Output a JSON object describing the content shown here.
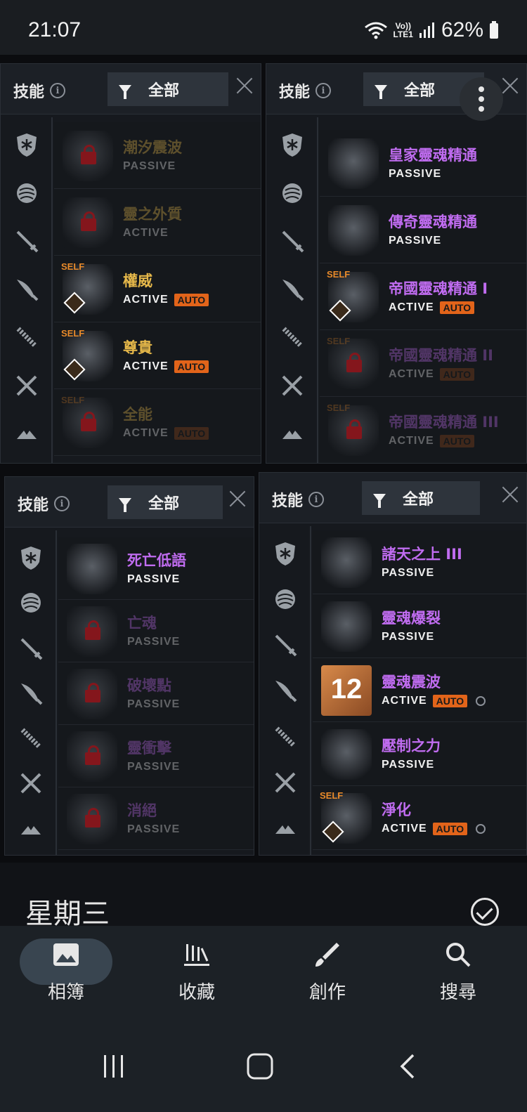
{
  "status_bar": {
    "time": "21:07",
    "network": "LTE1",
    "volte": "Vo))",
    "battery": "62%"
  },
  "panels": [
    {
      "title": "技能",
      "filter": "全部",
      "rows": [
        {
          "name": "潮汐震波",
          "type": "PASSIVE",
          "locked": true,
          "color": "gold"
        },
        {
          "name": "靈之外質",
          "type": "ACTIVE",
          "locked": true,
          "color": "gold"
        },
        {
          "name": "權威",
          "type": "ACTIVE",
          "auto": "AUTO",
          "self": "SELF",
          "locked": false,
          "color": "gold"
        },
        {
          "name": "尊貴",
          "type": "ACTIVE",
          "auto": "AUTO",
          "self": "SELF",
          "locked": false,
          "color": "gold"
        },
        {
          "name": "全能",
          "type": "ACTIVE",
          "auto": "AUTO",
          "self": "SELF",
          "locked": true,
          "color": "gold"
        }
      ]
    },
    {
      "title": "技能",
      "filter": "全部",
      "rows": [
        {
          "name": "皇家靈魂精通",
          "type": "PASSIVE",
          "locked": false,
          "color": "purple"
        },
        {
          "name": "傳奇靈魂精通",
          "type": "PASSIVE",
          "locked": false,
          "color": "purple"
        },
        {
          "name": "帝國靈魂精通 I",
          "type": "ACTIVE",
          "auto": "AUTO",
          "self": "SELF",
          "locked": false,
          "color": "purple"
        },
        {
          "name": "帝國靈魂精通 II",
          "type": "ACTIVE",
          "auto": "AUTO",
          "self": "SELF",
          "locked": true,
          "color": "purple"
        },
        {
          "name": "帝國靈魂精通 III",
          "type": "ACTIVE",
          "auto": "AUTO",
          "self": "SELF",
          "locked": true,
          "color": "purple"
        }
      ]
    },
    {
      "title": "技能",
      "filter": "全部",
      "rows": [
        {
          "name": "死亡低語",
          "type": "PASSIVE",
          "locked": false,
          "color": "purple"
        },
        {
          "name": "亡魂",
          "type": "PASSIVE",
          "locked": true,
          "color": "purple"
        },
        {
          "name": "破壞點",
          "type": "PASSIVE",
          "locked": true,
          "color": "purple"
        },
        {
          "name": "靈衝擊",
          "type": "PASSIVE",
          "locked": true,
          "color": "purple"
        },
        {
          "name": "消絕",
          "type": "PASSIVE",
          "locked": true,
          "color": "purple"
        }
      ]
    },
    {
      "title": "技能",
      "filter": "全部",
      "rows": [
        {
          "name": "諸天之上 III",
          "type": "PASSIVE",
          "locked": false,
          "color": "purple"
        },
        {
          "name": "靈魂爆裂",
          "type": "PASSIVE",
          "locked": false,
          "color": "purple"
        },
        {
          "name": "靈魂震波",
          "type": "ACTIVE",
          "auto": "AUTO",
          "locked": false,
          "color": "purple",
          "number": "12",
          "timer": true
        },
        {
          "name": "壓制之力",
          "type": "PASSIVE",
          "locked": false,
          "color": "purple"
        },
        {
          "name": "淨化",
          "type": "ACTIVE",
          "auto": "AUTO",
          "self": "SELF",
          "locked": false,
          "color": "purple",
          "timer": true
        }
      ]
    }
  ],
  "day_header": {
    "label": "星期三"
  },
  "bottom_nav": [
    {
      "label": "相簿",
      "icon": "photo-icon",
      "active": true
    },
    {
      "label": "收藏",
      "icon": "library-icon",
      "active": false
    },
    {
      "label": "創作",
      "icon": "brush-icon",
      "active": false
    },
    {
      "label": "搜尋",
      "icon": "search-icon",
      "active": false
    }
  ],
  "colors": {
    "gold": "#e6b84a",
    "purple": "#c06cf0",
    "auto": "#e2641a",
    "lock": "#e0161c",
    "nav_bg": "#1c2126",
    "active_pill": "#394550"
  }
}
